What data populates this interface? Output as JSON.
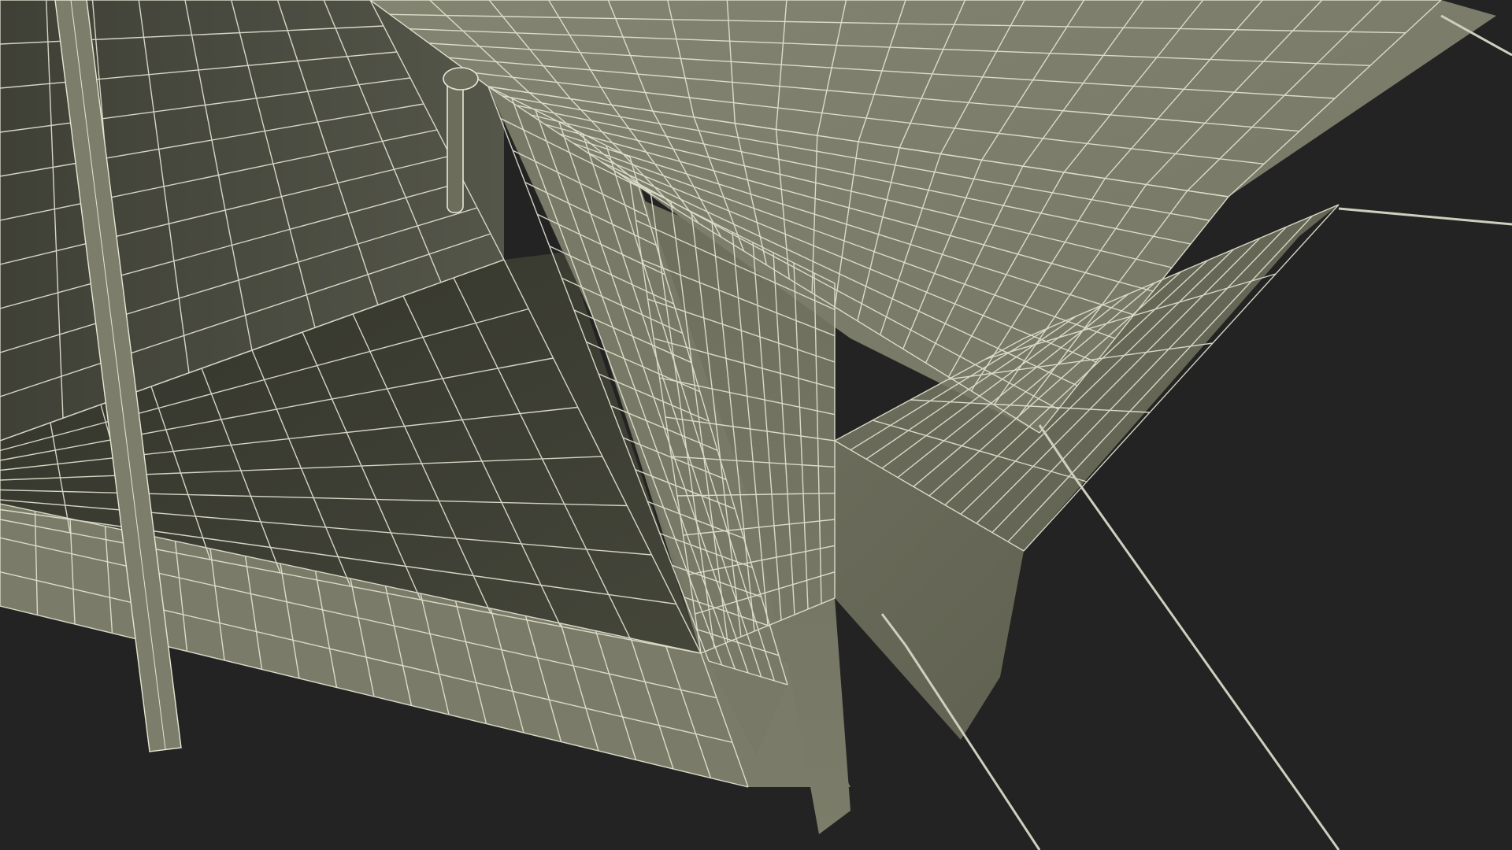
{
  "scene": {
    "subject": "wireframe-render",
    "colors": {
      "background": "#232323",
      "fabric_light": "#7a7b68",
      "fabric_mid": "#6c6d5b",
      "fabric_dark": "#5c5d4c",
      "interior_wall": "#4a4b3f",
      "interior_floor": "#3c3d33",
      "wire": "#e6e6d4",
      "rope": "#cfcfbf"
    },
    "icons": {
      "tent_pole": "pole-shape",
      "guy_ropes": "rope-line"
    }
  }
}
